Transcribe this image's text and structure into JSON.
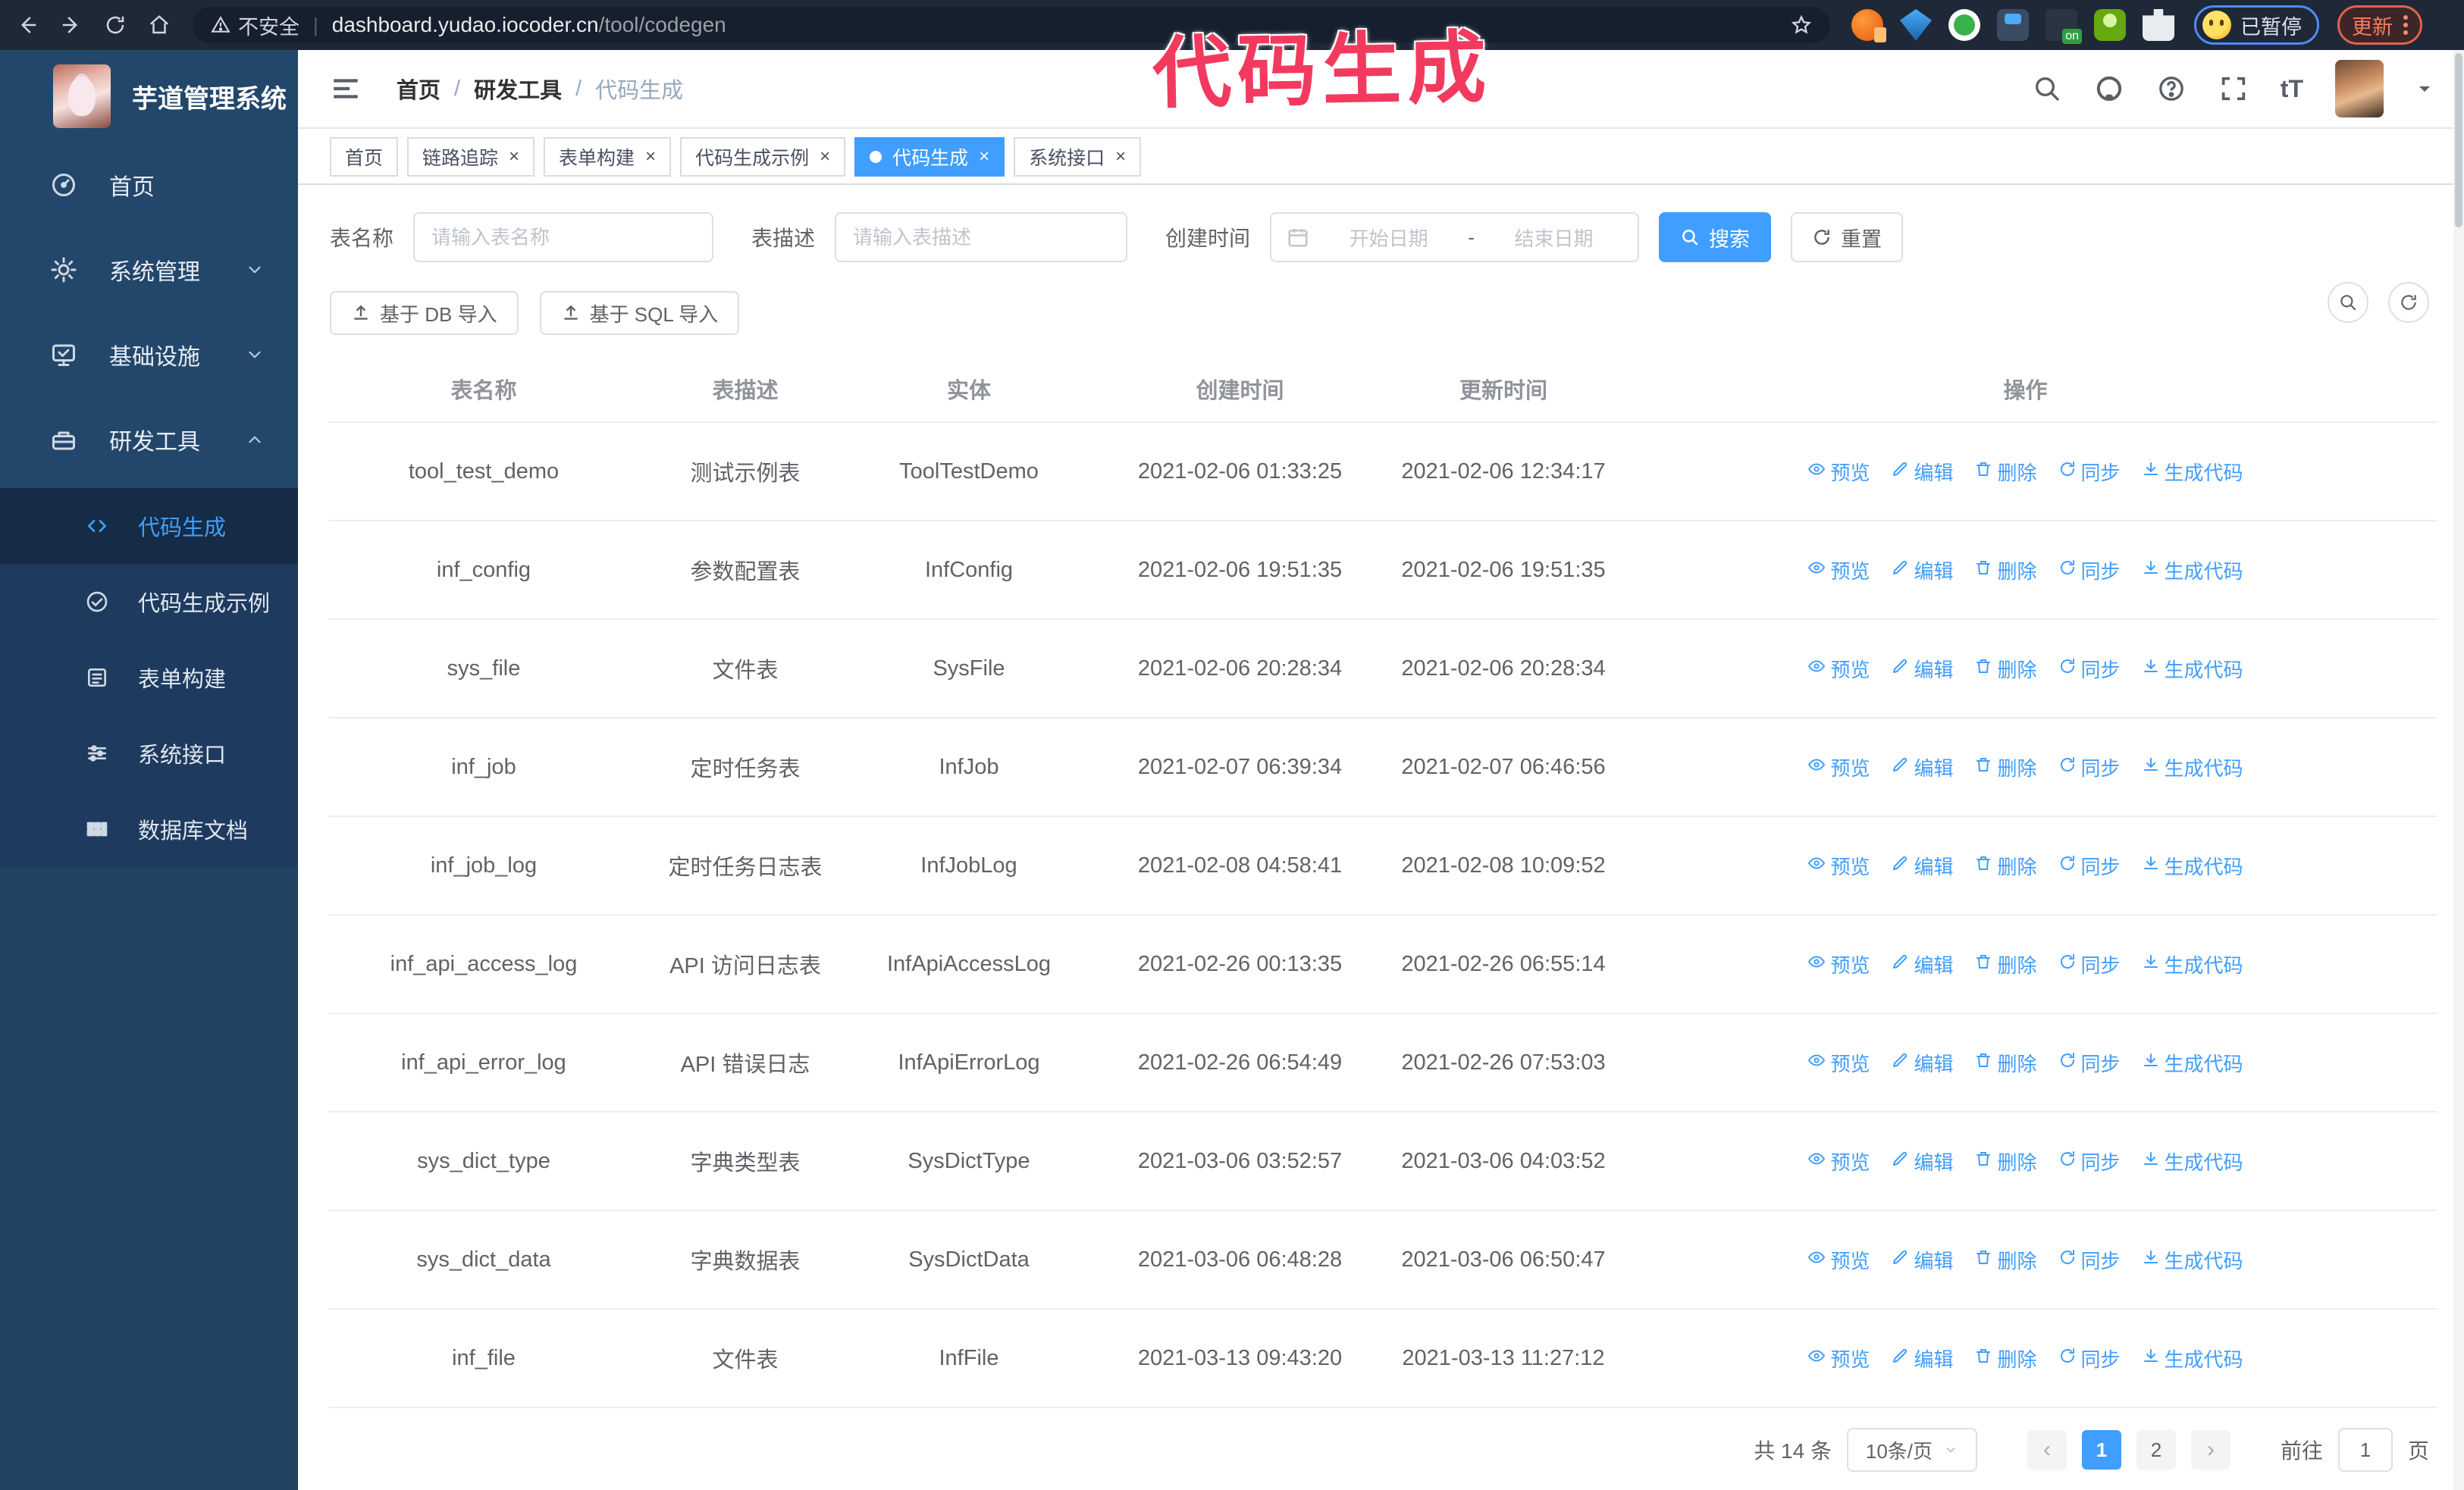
{
  "browser": {
    "security_label": "不安全",
    "url_domain": "dashboard.yudao.iocoder.cn",
    "url_path": "/tool/codegen",
    "paused_badge": "已暂停",
    "update_button": "更新"
  },
  "annotation": {
    "text": "代码生成",
    "color": "#f23a5f"
  },
  "sidebar": {
    "title": "芋道管理系统",
    "items": [
      {
        "label": "首页",
        "icon": "dashboard-icon",
        "arrow": "none"
      },
      {
        "label": "系统管理",
        "icon": "gear-icon",
        "arrow": "down"
      },
      {
        "label": "基础设施",
        "icon": "monitor-icon",
        "arrow": "down"
      },
      {
        "label": "研发工具",
        "icon": "toolbox-icon",
        "arrow": "up"
      }
    ],
    "subitems": [
      {
        "label": "代码生成",
        "icon": "code-icon",
        "active": true
      },
      {
        "label": "代码生成示例",
        "icon": "example-check-icon",
        "active": false
      },
      {
        "label": "表单构建",
        "icon": "form-icon",
        "active": false
      },
      {
        "label": "系统接口",
        "icon": "api-sliders-icon",
        "active": false
      },
      {
        "label": "数据库文档",
        "icon": "database-doc-icon",
        "active": false
      }
    ]
  },
  "header": {
    "breadcrumb": [
      "首页",
      "研发工具",
      "代码生成"
    ]
  },
  "tabs": [
    {
      "label": "首页",
      "closable": false,
      "active": false
    },
    {
      "label": "链路追踪",
      "closable": true,
      "active": false
    },
    {
      "label": "表单构建",
      "closable": true,
      "active": false
    },
    {
      "label": "代码生成示例",
      "closable": true,
      "active": false
    },
    {
      "label": "代码生成",
      "closable": true,
      "active": true
    },
    {
      "label": "系统接口",
      "closable": true,
      "active": false
    }
  ],
  "search_form": {
    "table_name_label": "表名称",
    "table_name_placeholder": "请输入表名称",
    "table_desc_label": "表描述",
    "table_desc_placeholder": "请输入表描述",
    "create_time_label": "创建时间",
    "date_start_placeholder": "开始日期",
    "date_separator": "-",
    "date_end_placeholder": "结束日期",
    "search_button": "搜索",
    "reset_button": "重置"
  },
  "import_toolbar": {
    "import_db_button": "基于 DB 导入",
    "import_sql_button": "基于 SQL 导入"
  },
  "table": {
    "columns": [
      "表名称",
      "表描述",
      "实体",
      "创建时间",
      "更新时间",
      "操作"
    ],
    "actions": [
      "预览",
      "编辑",
      "删除",
      "同步",
      "生成代码"
    ],
    "rows": [
      {
        "name": "tool_test_demo",
        "desc": "测试示例表",
        "entity": "ToolTestDemo",
        "created": "2021-02-06 01:33:25",
        "updated": "2021-02-06 12:34:17"
      },
      {
        "name": "inf_config",
        "desc": "参数配置表",
        "entity": "InfConfig",
        "created": "2021-02-06 19:51:35",
        "updated": "2021-02-06 19:51:35"
      },
      {
        "name": "sys_file",
        "desc": "文件表",
        "entity": "SysFile",
        "created": "2021-02-06 20:28:34",
        "updated": "2021-02-06 20:28:34"
      },
      {
        "name": "inf_job",
        "desc": "定时任务表",
        "entity": "InfJob",
        "created": "2021-02-07 06:39:34",
        "updated": "2021-02-07 06:46:56"
      },
      {
        "name": "inf_job_log",
        "desc": "定时任务日志表",
        "entity": "InfJobLog",
        "created": "2021-02-08 04:58:41",
        "updated": "2021-02-08 10:09:52"
      },
      {
        "name": "inf_api_access_log",
        "desc": "API 访问日志表",
        "entity": "InfApiAccessLog",
        "created": "2021-02-26 00:13:35",
        "updated": "2021-02-26 06:55:14"
      },
      {
        "name": "inf_api_error_log",
        "desc": "API 错误日志",
        "entity": "InfApiErrorLog",
        "created": "2021-02-26 06:54:49",
        "updated": "2021-02-26 07:53:03"
      },
      {
        "name": "sys_dict_type",
        "desc": "字典类型表",
        "entity": "SysDictType",
        "created": "2021-03-06 03:52:57",
        "updated": "2021-03-06 04:03:52"
      },
      {
        "name": "sys_dict_data",
        "desc": "字典数据表",
        "entity": "SysDictData",
        "created": "2021-03-06 06:48:28",
        "updated": "2021-03-06 06:50:47"
      },
      {
        "name": "inf_file",
        "desc": "文件表",
        "entity": "InfFile",
        "created": "2021-03-13 09:43:20",
        "updated": "2021-03-13 11:27:12"
      }
    ]
  },
  "pagination": {
    "total_text": "共 14 条",
    "page_size": "10条/页",
    "pages": [
      "1",
      "2"
    ],
    "active_page": "1",
    "prev_symbol": "‹",
    "next_symbol": "›",
    "goto_label": "前往",
    "goto_value": "1",
    "goto_suffix": "页"
  },
  "colors": {
    "accent": "#409eff",
    "sidebar_bg": "#1f4360",
    "sidebar_top_bg": "#23476b",
    "submenu_bg": "#1e3a5e",
    "annotation": "#f23a5f",
    "update_button": "#e4614d",
    "paused_chip_border": "#4e8cf7"
  }
}
